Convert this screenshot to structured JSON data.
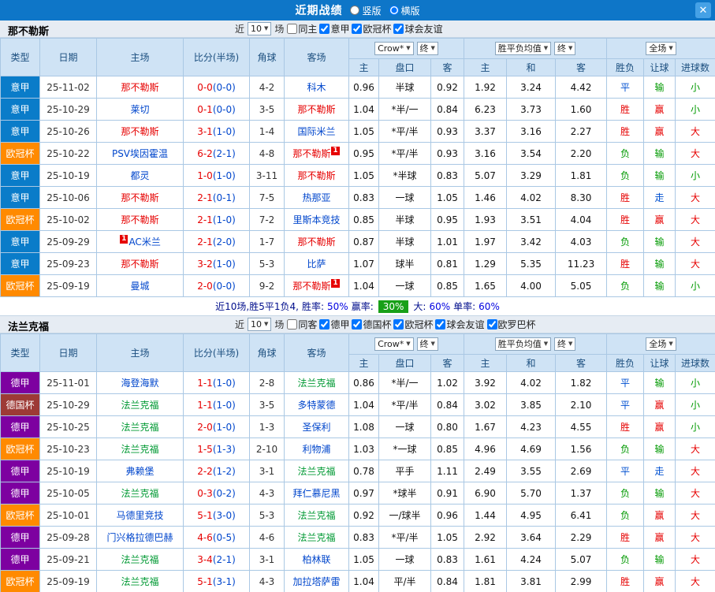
{
  "icons": {
    "close": "✕",
    "dropdown": "▼"
  },
  "colors": {
    "titlebar": "#0e76c8",
    "opponent": "#0046cc",
    "league": {
      "意甲": "#0a7cc9",
      "欧冠杯": "#ff8a00",
      "德甲": "#7d00a0",
      "德国杯": "#9d3a36"
    },
    "result": {
      "胜": "red",
      "平": "blue",
      "负": "green",
      "赢": "red",
      "走": "blue",
      "输": "green",
      "大": "red",
      "小": "green"
    },
    "summary_highlight": "#18a018"
  },
  "title_bar": {
    "title": "近期战绩",
    "radios": [
      {
        "label": "竖版",
        "checked": false
      },
      {
        "label": "横版",
        "checked": true
      }
    ]
  },
  "header": {
    "type": "类型",
    "date": "日期",
    "home": "主场",
    "score": "比分(半场)",
    "corners": "角球",
    "away": "客场",
    "book": "Crow*",
    "final1": "终",
    "o_home": "主",
    "o_hcap": "盘口",
    "o_away": "客",
    "avg": "胜平负均值",
    "final2": "终",
    "a_home": "主",
    "a_draw": "和",
    "a_away": "客",
    "scope": "全场",
    "wl": "胜负",
    "rg": "让球",
    "goals": "进球数"
  },
  "sections": [
    {
      "team": "那不勒斯",
      "team_color": "#e60000",
      "filter": {
        "near": "近",
        "count": "10",
        "unit": "场",
        "options": [
          {
            "label": "同主",
            "checked": false
          },
          {
            "label": "意甲",
            "checked": true
          },
          {
            "label": "欧冠杯",
            "checked": true
          },
          {
            "label": "球会友谊",
            "checked": true
          }
        ]
      },
      "rows": [
        {
          "league": "意甲",
          "date": "25-11-02",
          "home": {
            "name": "那不勒斯",
            "focal": true
          },
          "ft": "0-0",
          "ht": "(0-0)",
          "corners": "4-2",
          "away": {
            "name": "科木"
          },
          "o1": "0.96",
          "hc": "半球",
          "o2": "0.92",
          "a1": "1.92",
          "a2": "3.24",
          "a3": "4.42",
          "r": [
            "平",
            "输",
            "小"
          ]
        },
        {
          "league": "意甲",
          "date": "25-10-29",
          "home": {
            "name": "莱切"
          },
          "ft": "0-1",
          "ht": "(0-0)",
          "corners": "3-5",
          "away": {
            "name": "那不勒斯",
            "focal": true
          },
          "o1": "1.04",
          "hc": "*半/一",
          "o2": "0.84",
          "a1": "6.23",
          "a2": "3.73",
          "a3": "1.60",
          "r": [
            "胜",
            "赢",
            "小"
          ]
        },
        {
          "league": "意甲",
          "date": "25-10-26",
          "home": {
            "name": "那不勒斯",
            "focal": true
          },
          "ft": "3-1",
          "ht": "(1-0)",
          "corners": "1-4",
          "away": {
            "name": "国际米兰"
          },
          "o1": "1.05",
          "hc": "*平/半",
          "o2": "0.93",
          "a1": "3.37",
          "a2": "3.16",
          "a3": "2.27",
          "r": [
            "胜",
            "赢",
            "大"
          ]
        },
        {
          "league": "欧冠杯",
          "date": "25-10-22",
          "home": {
            "name": "PSV埃因霍温"
          },
          "ft": "6-2",
          "ht": "(2-1)",
          "corners": "4-8",
          "away": {
            "name": "那不勒斯",
            "focal": true,
            "badge": "1"
          },
          "o1": "0.95",
          "hc": "*平/半",
          "o2": "0.93",
          "a1": "3.16",
          "a2": "3.54",
          "a3": "2.20",
          "r": [
            "负",
            "输",
            "大"
          ]
        },
        {
          "league": "意甲",
          "date": "25-10-19",
          "home": {
            "name": "都灵"
          },
          "ft": "1-0",
          "ht": "(1-0)",
          "corners": "3-11",
          "away": {
            "name": "那不勒斯",
            "focal": true
          },
          "o1": "1.05",
          "hc": "*半球",
          "o2": "0.83",
          "a1": "5.07",
          "a2": "3.29",
          "a3": "1.81",
          "r": [
            "负",
            "输",
            "小"
          ]
        },
        {
          "league": "意甲",
          "date": "25-10-06",
          "home": {
            "name": "那不勒斯",
            "focal": true
          },
          "ft": "2-1",
          "ht": "(0-1)",
          "corners": "7-5",
          "away": {
            "name": "热那亚"
          },
          "o1": "0.83",
          "hc": "一球",
          "o2": "1.05",
          "a1": "1.46",
          "a2": "4.02",
          "a3": "8.30",
          "r": [
            "胜",
            "走",
            "大"
          ]
        },
        {
          "league": "欧冠杯",
          "date": "25-10-02",
          "home": {
            "name": "那不勒斯",
            "focal": true
          },
          "ft": "2-1",
          "ht": "(1-0)",
          "corners": "7-2",
          "away": {
            "name": "里斯本竞技"
          },
          "o1": "0.85",
          "hc": "半球",
          "o2": "0.95",
          "a1": "1.93",
          "a2": "3.51",
          "a3": "4.04",
          "r": [
            "胜",
            "赢",
            "大"
          ]
        },
        {
          "league": "意甲",
          "date": "25-09-29",
          "home": {
            "name": "AC米兰",
            "badge": "1",
            "badge_pos": "pre"
          },
          "ft": "2-1",
          "ht": "(2-0)",
          "corners": "1-7",
          "away": {
            "name": "那不勒斯",
            "focal": true
          },
          "o1": "0.87",
          "hc": "半球",
          "o2": "1.01",
          "a1": "1.97",
          "a2": "3.42",
          "a3": "4.03",
          "r": [
            "负",
            "输",
            "大"
          ]
        },
        {
          "league": "意甲",
          "date": "25-09-23",
          "home": {
            "name": "那不勒斯",
            "focal": true
          },
          "ft": "3-2",
          "ht": "(1-0)",
          "corners": "5-3",
          "away": {
            "name": "比萨"
          },
          "o1": "1.07",
          "hc": "球半",
          "o2": "0.81",
          "a1": "1.29",
          "a2": "5.35",
          "a3": "11.23",
          "r": [
            "胜",
            "输",
            "大"
          ]
        },
        {
          "league": "欧冠杯",
          "date": "25-09-19",
          "home": {
            "name": "曼城"
          },
          "ft": "2-0",
          "ht": "(0-0)",
          "corners": "9-2",
          "away": {
            "name": "那不勒斯",
            "focal": true,
            "badge": "1"
          },
          "o1": "1.04",
          "hc": "一球",
          "o2": "0.85",
          "a1": "1.65",
          "a2": "4.00",
          "a3": "5.05",
          "r": [
            "负",
            "输",
            "小"
          ]
        }
      ],
      "summary": {
        "record": "近10场,胜5平1负4,",
        "win_label": "胜率:",
        "win_value": "50%",
        "asia_label": "赢率:",
        "asia_value": "30%",
        "big_label": "大:",
        "big_value": "60%",
        "single_label": "单率:",
        "single_value": "60%"
      }
    },
    {
      "team": "法兰克福",
      "team_color": "#009933",
      "filter": {
        "near": "近",
        "count": "10",
        "unit": "场",
        "options": [
          {
            "label": "同客",
            "checked": false
          },
          {
            "label": "德甲",
            "checked": true
          },
          {
            "label": "德国杯",
            "checked": true
          },
          {
            "label": "欧冠杯",
            "checked": true
          },
          {
            "label": "球会友谊",
            "checked": true
          },
          {
            "label": "欧罗巴杯",
            "checked": true
          }
        ]
      },
      "rows": [
        {
          "league": "德甲",
          "date": "25-11-01",
          "home": {
            "name": "海登海默"
          },
          "ft": "1-1",
          "ht": "(1-0)",
          "corners": "2-8",
          "away": {
            "name": "法兰克福",
            "focal": true
          },
          "o1": "0.86",
          "hc": "*半/一",
          "o2": "1.02",
          "a1": "3.92",
          "a2": "4.02",
          "a3": "1.82",
          "r": [
            "平",
            "输",
            "小"
          ]
        },
        {
          "league": "德国杯",
          "date": "25-10-29",
          "home": {
            "name": "法兰克福",
            "focal": true
          },
          "ft": "1-1",
          "ht": "(1-0)",
          "corners": "3-5",
          "away": {
            "name": "多特蒙德"
          },
          "o1": "1.04",
          "hc": "*平/半",
          "o2": "0.84",
          "a1": "3.02",
          "a2": "3.85",
          "a3": "2.10",
          "r": [
            "平",
            "赢",
            "小"
          ]
        },
        {
          "league": "德甲",
          "date": "25-10-25",
          "home": {
            "name": "法兰克福",
            "focal": true
          },
          "ft": "2-0",
          "ht": "(1-0)",
          "corners": "1-3",
          "away": {
            "name": "圣保利"
          },
          "o1": "1.08",
          "hc": "一球",
          "o2": "0.80",
          "a1": "1.67",
          "a2": "4.23",
          "a3": "4.55",
          "r": [
            "胜",
            "赢",
            "小"
          ]
        },
        {
          "league": "欧冠杯",
          "date": "25-10-23",
          "home": {
            "name": "法兰克福",
            "focal": true
          },
          "ft": "1-5",
          "ht": "(1-3)",
          "corners": "2-10",
          "away": {
            "name": "利物浦"
          },
          "o1": "1.03",
          "hc": "*一球",
          "o2": "0.85",
          "a1": "4.96",
          "a2": "4.69",
          "a3": "1.56",
          "r": [
            "负",
            "输",
            "大"
          ]
        },
        {
          "league": "德甲",
          "date": "25-10-19",
          "home": {
            "name": "弗赖堡"
          },
          "ft": "2-2",
          "ht": "(1-2)",
          "corners": "3-1",
          "away": {
            "name": "法兰克福",
            "focal": true
          },
          "o1": "0.78",
          "hc": "平手",
          "o2": "1.11",
          "a1": "2.49",
          "a2": "3.55",
          "a3": "2.69",
          "r": [
            "平",
            "走",
            "大"
          ]
        },
        {
          "league": "德甲",
          "date": "25-10-05",
          "home": {
            "name": "法兰克福",
            "focal": true
          },
          "ft": "0-3",
          "ht": "(0-2)",
          "corners": "4-3",
          "away": {
            "name": "拜仁慕尼黑"
          },
          "o1": "0.97",
          "hc": "*球半",
          "o2": "0.91",
          "a1": "6.90",
          "a2": "5.70",
          "a3": "1.37",
          "r": [
            "负",
            "输",
            "大"
          ]
        },
        {
          "league": "欧冠杯",
          "date": "25-10-01",
          "home": {
            "name": "马德里竞技"
          },
          "ft": "5-1",
          "ht": "(3-0)",
          "corners": "5-3",
          "away": {
            "name": "法兰克福",
            "focal": true
          },
          "o1": "0.92",
          "hc": "一/球半",
          "o2": "0.96",
          "a1": "1.44",
          "a2": "4.95",
          "a3": "6.41",
          "r": [
            "负",
            "赢",
            "大"
          ]
        },
        {
          "league": "德甲",
          "date": "25-09-28",
          "home": {
            "name": "门兴格拉德巴赫"
          },
          "ft": "4-6",
          "ht": "(0-5)",
          "corners": "4-6",
          "away": {
            "name": "法兰克福",
            "focal": true
          },
          "o1": "0.83",
          "hc": "*平/半",
          "o2": "1.05",
          "a1": "2.92",
          "a2": "3.64",
          "a3": "2.29",
          "r": [
            "胜",
            "赢",
            "大"
          ]
        },
        {
          "league": "德甲",
          "date": "25-09-21",
          "home": {
            "name": "法兰克福",
            "focal": true
          },
          "ft": "3-4",
          "ht": "(2-1)",
          "corners": "3-1",
          "away": {
            "name": "柏林联"
          },
          "o1": "1.05",
          "hc": "一球",
          "o2": "0.83",
          "a1": "1.61",
          "a2": "4.24",
          "a3": "5.07",
          "r": [
            "负",
            "输",
            "大"
          ]
        },
        {
          "league": "欧冠杯",
          "date": "25-09-19",
          "home": {
            "name": "法兰克福",
            "focal": true
          },
          "ft": "5-1",
          "ht": "(3-1)",
          "corners": "4-3",
          "away": {
            "name": "加拉塔萨雷"
          },
          "o1": "1.04",
          "hc": "平/半",
          "o2": "0.84",
          "a1": "1.81",
          "a2": "3.81",
          "a3": "2.99",
          "r": [
            "胜",
            "赢",
            "大"
          ]
        }
      ]
    }
  ]
}
